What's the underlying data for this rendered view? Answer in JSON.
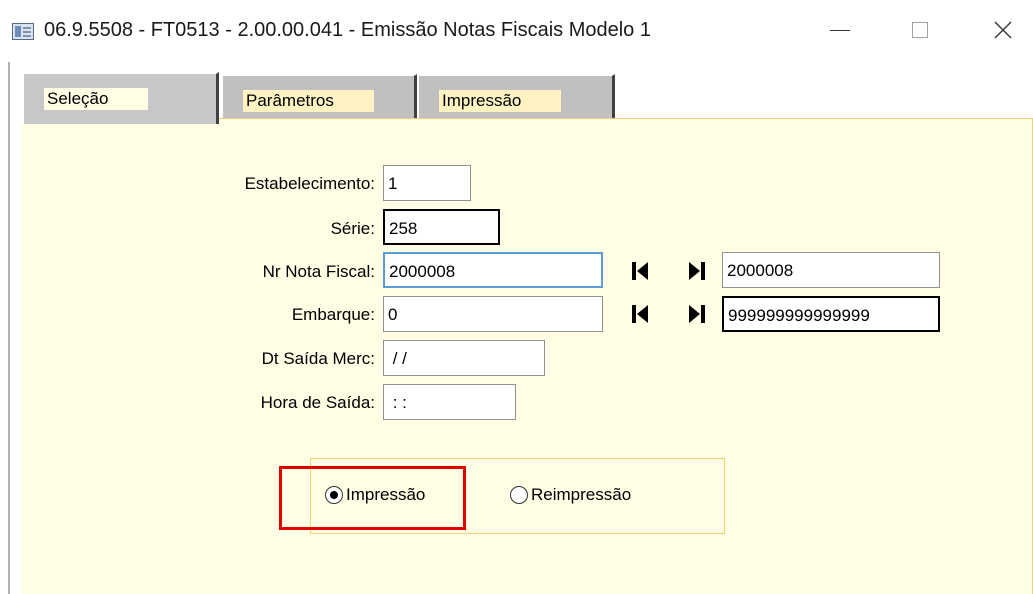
{
  "window": {
    "title": "06.9.5508 - FT0513 - 2.00.00.041 - Emissão Notas Fiscais Modelo 1",
    "minimize_symbol": "—",
    "maximize_symbol": "□",
    "close_symbol": "✕"
  },
  "tabs": [
    {
      "label": "Seleção",
      "selected": true
    },
    {
      "label": "Parâmetros",
      "selected": false
    },
    {
      "label": "Impressão",
      "selected": false
    }
  ],
  "form": {
    "estabelecimento": {
      "label": "Estabelecimento:",
      "value": "1"
    },
    "serie": {
      "label": "Série:",
      "value": "258"
    },
    "nr_nota_fiscal": {
      "label": "Nr Nota Fiscal:",
      "value_from": "2000008",
      "value_to": "2000008"
    },
    "embarque": {
      "label": "Embarque:",
      "value_from": "0",
      "value_to": "999999999999999"
    },
    "dt_saida_merc": {
      "label": "Dt Saída Merc:",
      "value": " / /"
    },
    "hora_saida": {
      "label": "Hora de Saída:",
      "value": " : :"
    }
  },
  "options": {
    "impressao": {
      "label": "Impressão",
      "checked": true
    },
    "reimpressao": {
      "label": "Reimpressão",
      "checked": false
    }
  },
  "icons": {
    "first": "first-record-icon",
    "last": "last-record-icon"
  },
  "colors": {
    "panel_bg": "#fffde4",
    "tab_label_bg": "#fff3c4",
    "highlight": "#e00000",
    "focus_border": "#5a9bd8"
  }
}
